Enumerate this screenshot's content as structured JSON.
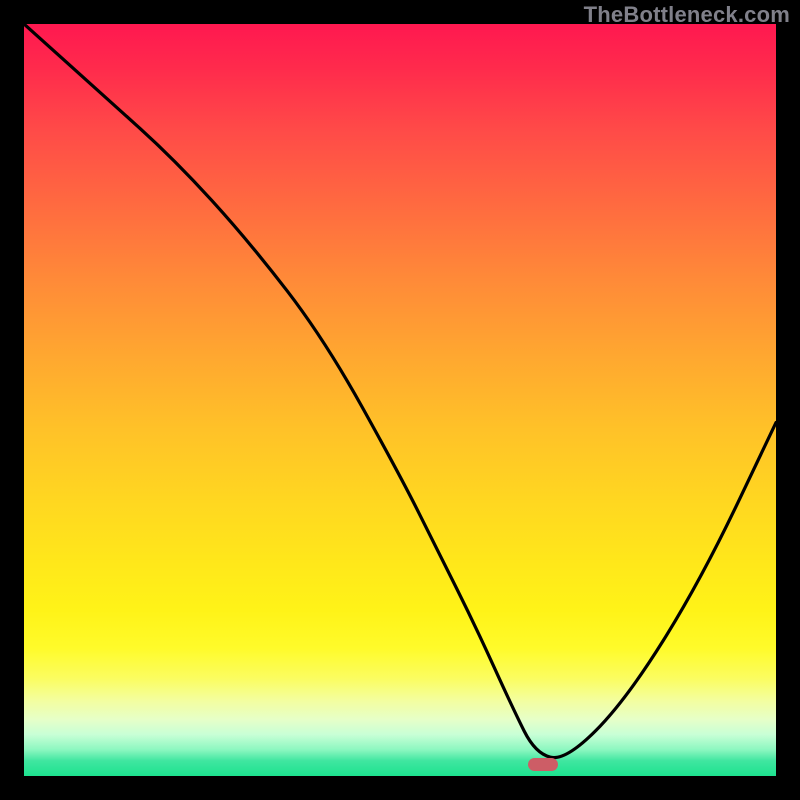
{
  "watermark": "TheBottleneck.com",
  "chart_data": {
    "type": "line",
    "title": "",
    "xlabel": "",
    "ylabel": "",
    "xlim": [
      0,
      100
    ],
    "ylim": [
      0,
      100
    ],
    "grid": false,
    "series": [
      {
        "name": "curve",
        "x": [
          0,
          10,
          20,
          30,
          40,
          50,
          55,
          60,
          65,
          68,
          72,
          80,
          90,
          100
        ],
        "values": [
          100,
          91,
          82,
          71,
          58,
          40,
          30,
          20,
          9,
          3,
          2,
          10,
          26,
          47
        ],
        "color": "#000000"
      }
    ],
    "annotations": [
      {
        "type": "marker",
        "x": 69,
        "y": 1.5,
        "shape": "rounded-rect",
        "color": "#cd5d66"
      }
    ]
  },
  "colors": {
    "gradient_top": "#ff1850",
    "gradient_bottom": "#1de28f",
    "frame": "#000000",
    "curve": "#000000",
    "marker": "#cd5d66",
    "watermark": "#80808a"
  }
}
